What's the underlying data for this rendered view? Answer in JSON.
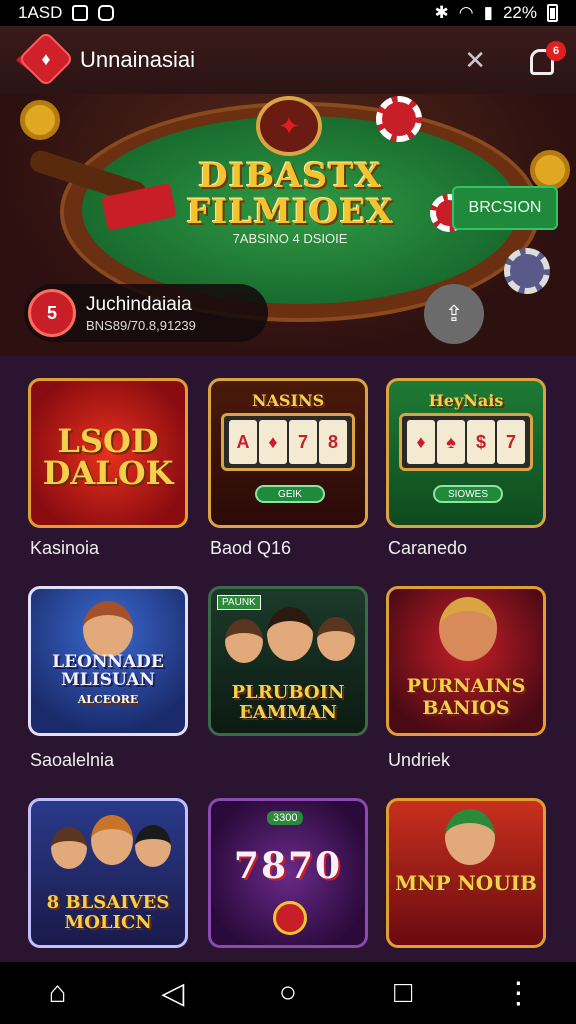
{
  "status_bar": {
    "time": "1ΑSD",
    "battery": "22%",
    "icons": [
      "image-icon",
      "app-icon",
      "bluetooth-icon",
      "wifi-icon",
      "signal-icon",
      "battery-icon"
    ]
  },
  "header": {
    "title": "Unnainasiai",
    "logo_icon": "brand-logo-icon",
    "notification_count": "6",
    "icons": [
      "back-arrow-icon",
      "tools-icon",
      "notification-bell-icon"
    ]
  },
  "banner": {
    "title": "DIBASTX FILMIOEX",
    "subtitle": "7ABSINO 4 DSIOIE",
    "cta_label": "BRCSION",
    "player": {
      "name": "Juchindaiaia",
      "id": "BNS89/70.8,91239",
      "avatar_text": "5"
    }
  },
  "games": [
    {
      "label": "Kasinoia",
      "art_text": "LSOD DALOK"
    },
    {
      "label": "Baod Q16",
      "art_text": "NASINS",
      "button": "GEIK"
    },
    {
      "label": "Caranedo",
      "art_text": "HeyNais",
      "button": "SIOWES"
    },
    {
      "label": "Saoalelnia",
      "art_text": "LEONNADE MLISUAN",
      "sub_text": "ALCEORE"
    },
    {
      "label": "",
      "art_text": "PLRUBOIN EAMMAN",
      "badge": "PAUNK"
    },
    {
      "label": "Undriek",
      "art_text": "PURNAINS BANIOS"
    },
    {
      "label": "",
      "art_text": "8 BLSAIVES MOLICN"
    },
    {
      "label": "",
      "art_text": "7870",
      "badge": "3300"
    },
    {
      "label": "",
      "art_text": "MNP NOUIB"
    }
  ],
  "nav": {
    "icons": [
      "home-icon",
      "back-icon",
      "home-circle-icon",
      "recents-icon",
      "more-icon"
    ]
  },
  "colors": {
    "background": "#2a1430",
    "accent_red": "#c81e28",
    "accent_gold": "#f4c430",
    "accent_green": "#1f8a3c"
  }
}
